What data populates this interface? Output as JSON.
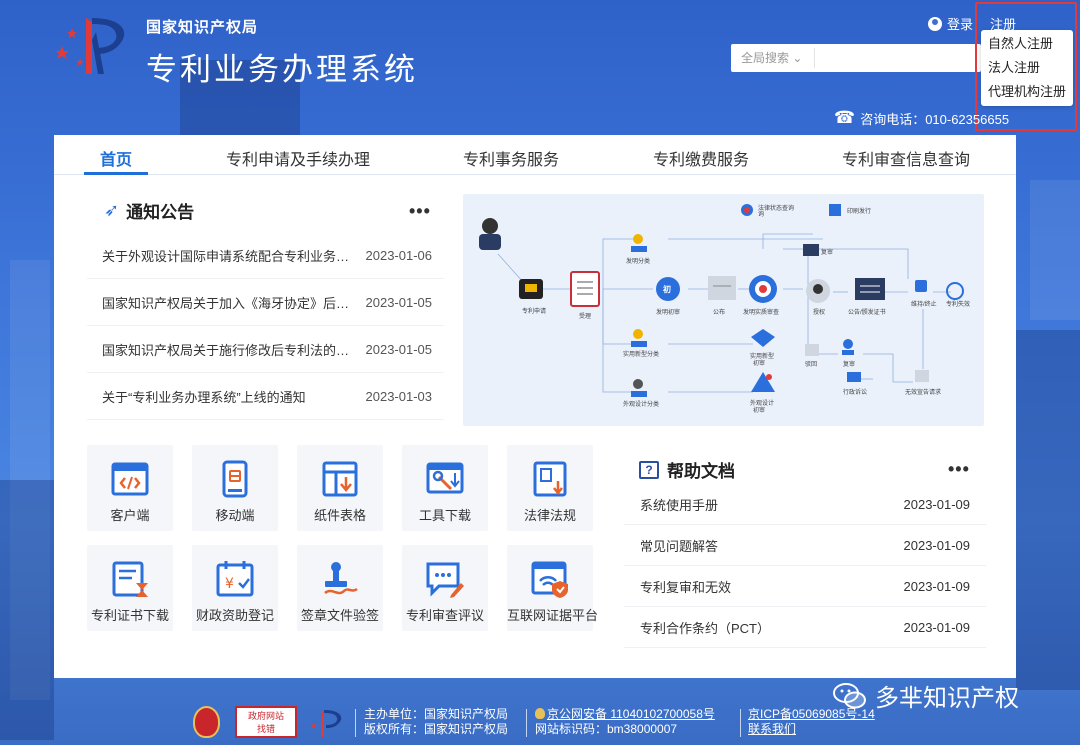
{
  "header": {
    "org_name": "国家知识产权局",
    "system_name": "专利业务办理系统",
    "login_label": "登录",
    "register_label": "注册",
    "register_menu": [
      "自然人注册",
      "法人注册",
      "代理机构注册"
    ],
    "search_select": "全局搜索 ⌄",
    "search_placeholder": "",
    "hotline": "咨询电话：010-62356655"
  },
  "nav": {
    "items": [
      "首页",
      "专利申请及手续办理",
      "专利事务服务",
      "专利缴费服务",
      "专利审查信息查询"
    ],
    "active": "首页"
  },
  "notices": {
    "title": "通知公告",
    "more": "•••",
    "items": [
      {
        "title": "关于外观设计国际申请系统配合专利业务办理系统上线的通知",
        "date": "2023-01-06"
      },
      {
        "title": "国家知识产权局关于加入《海牙协定》后相关业务处理的公告",
        "date": "2023-01-05"
      },
      {
        "title": "国家知识产权局关于施行修改后专利法的相关审查业务处理暂行办法的公告",
        "date": "2023-01-05"
      },
      {
        "title": "关于“专利业务办理系统”上线的通知",
        "date": "2023-01-03"
      }
    ]
  },
  "flow": {
    "labels": {
      "apply": "专利申请",
      "receive": "受理",
      "prelim": "发明初审",
      "publish": "公布",
      "substantive": "发明实质审查",
      "register": "授权",
      "cert": "公告/颁发证书",
      "termination": "终止",
      "expire": "专利失效",
      "utility": "实用新型初审",
      "design": "外观设计初审",
      "reexam": "复审",
      "reject": "驳回",
      "invalid": "无效宣告",
      "admin": "行政诉讼",
      "fee": "年费缴纳",
      "refund": "驳回",
      "consult": "法律状态查询",
      "change": "著录变更",
      "practical": "实用新型初审",
      "design2": "外观设计初审",
      "notify": "通知书"
    }
  },
  "tools": [
    {
      "label": "客户端",
      "icon": "code-window-icon"
    },
    {
      "label": "移动端",
      "icon": "mobile-icon"
    },
    {
      "label": "纸件表格",
      "icon": "table-download-icon"
    },
    {
      "label": "工具下载",
      "icon": "tools-download-icon"
    },
    {
      "label": "法律法规",
      "icon": "law-book-icon"
    },
    {
      "label": "专利证书下载",
      "icon": "certificate-icon"
    },
    {
      "label": "财政资助登记",
      "icon": "yen-calendar-icon"
    },
    {
      "label": "签章文件验签",
      "icon": "stamp-icon"
    },
    {
      "label": "专利审查评议",
      "icon": "comment-edit-icon"
    },
    {
      "label": "互联网证据平台",
      "icon": "evidence-shield-icon"
    }
  ],
  "help": {
    "title": "帮助文档",
    "more": "•••",
    "items": [
      {
        "title": "系统使用手册",
        "date": "2023-01-09"
      },
      {
        "title": "常见问题解答",
        "date": "2023-01-09"
      },
      {
        "title": "专利复审和无效",
        "date": "2023-01-09"
      },
      {
        "title": "专利合作条约（PCT）",
        "date": "2023-01-09"
      }
    ]
  },
  "footer": {
    "gov_badge": "政府网站\n找错",
    "sponsor": "主办单位：国家知识产权局",
    "copyright": "版权所有：国家知识产权局",
    "police": "京公网安备 11040102700058号",
    "site_code": "网站标识码：bm38000007",
    "icp": "京ICP备05069085号-14",
    "contact": "联系我们"
  },
  "watermark": "多芈知识产权",
  "colors": {
    "primary": "#1e6fd9",
    "background": "#3c74d8",
    "highlight_border": "#e23a3a"
  }
}
